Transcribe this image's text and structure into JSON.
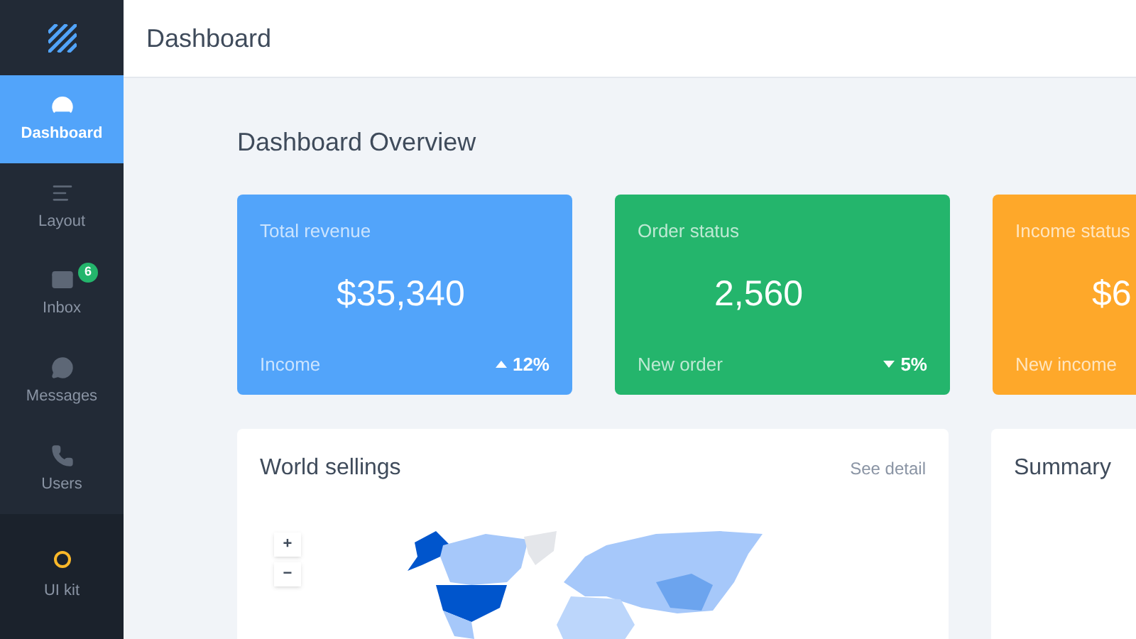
{
  "header": {
    "title": "Dashboard"
  },
  "sidebar": {
    "items": [
      {
        "label": "Dashboard",
        "selected": true
      },
      {
        "label": "Layout",
        "selected": false
      },
      {
        "label": "Inbox",
        "selected": false,
        "badge": "6"
      },
      {
        "label": "Messages",
        "selected": false
      },
      {
        "label": "Users",
        "selected": false
      }
    ],
    "footer_item": {
      "label": "UI kit",
      "selected": false
    }
  },
  "page_title": "Dashboard Overview",
  "stat_cards": [
    {
      "title": "Total revenue",
      "value": "$35,340",
      "footer": "Income",
      "kind": "up",
      "change": "12%",
      "color": "#52a4fa"
    },
    {
      "title": "Order status",
      "value": "2,560",
      "footer": "New order",
      "kind": "down",
      "change": "5%",
      "color": "#24b56c"
    },
    {
      "title": "Income status",
      "value": "$6",
      "footer": "New income",
      "color": "#fea82a"
    }
  ],
  "world_panel": {
    "title": "World sellings",
    "link": "See detail",
    "zoom_in": "+",
    "zoom_out": "−"
  },
  "summary_panel": {
    "title": "Summary"
  }
}
